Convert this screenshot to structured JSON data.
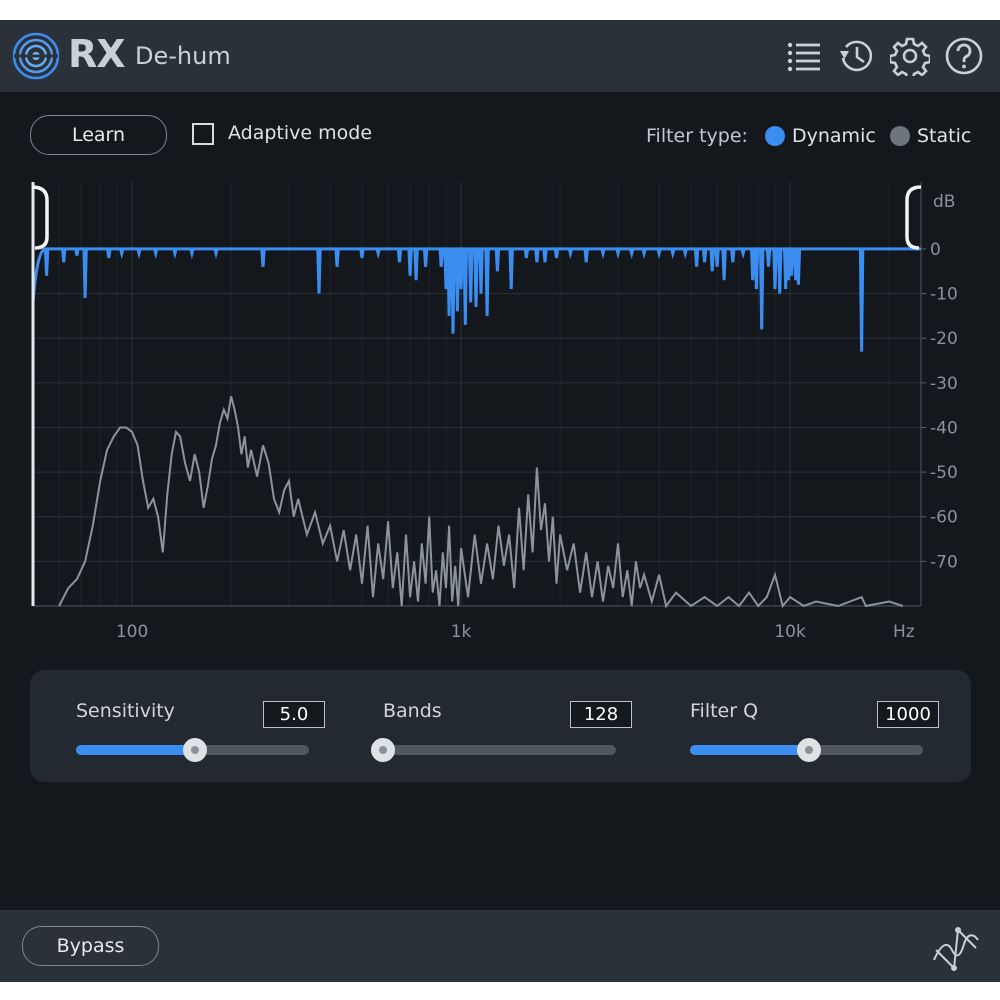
{
  "header": {
    "brand": "RX",
    "plugin_name": "De-hum",
    "icons": [
      "presets-list-icon",
      "history-icon",
      "settings-gear-icon",
      "help-icon"
    ]
  },
  "controls": {
    "learn_label": "Learn",
    "adaptive_mode_label": "Adaptive mode",
    "adaptive_mode_checked": false,
    "filter_type_label": "Filter type:",
    "filter_options": [
      "Dynamic",
      "Static"
    ],
    "filter_selected": "Dynamic"
  },
  "chart_data": {
    "type": "line",
    "x_scale": "log",
    "xlim": [
      50,
      25000
    ],
    "x_ticks": [
      {
        "value": 100,
        "label": "100"
      },
      {
        "value": 1000,
        "label": "1k"
      },
      {
        "value": 10000,
        "label": "10k"
      }
    ],
    "x_unit_label": "Hz",
    "y_unit_label": "dB",
    "ylim": [
      -80,
      15
    ],
    "y_ticks": [
      {
        "value": 0,
        "label": "0"
      },
      {
        "value": -10,
        "label": "-10"
      },
      {
        "value": -20,
        "label": "-20"
      },
      {
        "value": -30,
        "label": "-30"
      },
      {
        "value": -40,
        "label": "-40"
      },
      {
        "value": -50,
        "label": "-50"
      },
      {
        "value": -60,
        "label": "-60"
      },
      {
        "value": -70,
        "label": "-70"
      }
    ],
    "grid": true,
    "series": [
      {
        "role": "filter-response",
        "color": "#3b8ef0",
        "baseline_db": 0,
        "notches": [
          [
            55,
            -6
          ],
          [
            62,
            -3
          ],
          [
            68,
            -1.5
          ],
          [
            72,
            -11
          ],
          [
            85,
            -2
          ],
          [
            93,
            -1
          ],
          [
            105,
            -1
          ],
          [
            118,
            -1
          ],
          [
            135,
            -1
          ],
          [
            152,
            -1
          ],
          [
            180,
            -1
          ],
          [
            250,
            -4
          ],
          [
            370,
            -10
          ],
          [
            420,
            -4
          ],
          [
            500,
            -2
          ],
          [
            560,
            -1
          ],
          [
            650,
            -3
          ],
          [
            700,
            -6
          ],
          [
            730,
            -7
          ],
          [
            780,
            -4
          ],
          [
            870,
            -4
          ],
          [
            900,
            -9
          ],
          [
            920,
            -15
          ],
          [
            945,
            -19
          ],
          [
            975,
            -14
          ],
          [
            1000,
            -9
          ],
          [
            1030,
            -17
          ],
          [
            1070,
            -12
          ],
          [
            1110,
            -13
          ],
          [
            1150,
            -10
          ],
          [
            1200,
            -15
          ],
          [
            1290,
            -5
          ],
          [
            1420,
            -9
          ],
          [
            1580,
            -2
          ],
          [
            1700,
            -3
          ],
          [
            1800,
            -3
          ],
          [
            1950,
            -2
          ],
          [
            2150,
            -1
          ],
          [
            2400,
            -3
          ],
          [
            2700,
            -1
          ],
          [
            3000,
            -1
          ],
          [
            3300,
            -1
          ],
          [
            3600,
            -1
          ],
          [
            4000,
            -1
          ],
          [
            4400,
            -1
          ],
          [
            4800,
            -1
          ],
          [
            5200,
            -4
          ],
          [
            5500,
            -3
          ],
          [
            5800,
            -5
          ],
          [
            6000,
            -4
          ],
          [
            6300,
            -7
          ],
          [
            6700,
            -3
          ],
          [
            7200,
            -1
          ],
          [
            7700,
            -7
          ],
          [
            7900,
            -9
          ],
          [
            8200,
            -18
          ],
          [
            8600,
            -4
          ],
          [
            9000,
            -9
          ],
          [
            9300,
            -10
          ],
          [
            9700,
            -9
          ],
          [
            9900,
            -7
          ],
          [
            10100,
            -6
          ],
          [
            10400,
            -7
          ],
          [
            10600,
            -8
          ],
          [
            16500,
            -23
          ]
        ]
      },
      {
        "role": "input-spectrum",
        "color": "#8b939b",
        "points": [
          [
            60,
            -80
          ],
          [
            64,
            -76
          ],
          [
            68,
            -74
          ],
          [
            72,
            -70
          ],
          [
            76,
            -62
          ],
          [
            80,
            -52
          ],
          [
            84,
            -45
          ],
          [
            88,
            -42
          ],
          [
            92,
            -40
          ],
          [
            96,
            -40
          ],
          [
            100,
            -41
          ],
          [
            104,
            -44
          ],
          [
            108,
            -52
          ],
          [
            112,
            -58
          ],
          [
            116,
            -56
          ],
          [
            120,
            -60
          ],
          [
            124,
            -68
          ],
          [
            128,
            -55
          ],
          [
            132,
            -46
          ],
          [
            136,
            -41
          ],
          [
            140,
            -42
          ],
          [
            145,
            -48
          ],
          [
            150,
            -52
          ],
          [
            155,
            -46
          ],
          [
            160,
            -50
          ],
          [
            165,
            -58
          ],
          [
            170,
            -53
          ],
          [
            175,
            -47
          ],
          [
            180,
            -44
          ],
          [
            185,
            -39
          ],
          [
            190,
            -36
          ],
          [
            195,
            -38
          ],
          [
            200,
            -33
          ],
          [
            205,
            -36
          ],
          [
            210,
            -40
          ],
          [
            215,
            -46
          ],
          [
            220,
            -42
          ],
          [
            225,
            -49
          ],
          [
            230,
            -45
          ],
          [
            240,
            -51
          ],
          [
            250,
            -44
          ],
          [
            260,
            -48
          ],
          [
            270,
            -56
          ],
          [
            280,
            -59
          ],
          [
            290,
            -54
          ],
          [
            300,
            -52
          ],
          [
            310,
            -60
          ],
          [
            320,
            -56
          ],
          [
            340,
            -64
          ],
          [
            360,
            -59
          ],
          [
            380,
            -66
          ],
          [
            400,
            -62
          ],
          [
            420,
            -70
          ],
          [
            440,
            -63
          ],
          [
            460,
            -72
          ],
          [
            480,
            -64
          ],
          [
            500,
            -75
          ],
          [
            520,
            -62
          ],
          [
            540,
            -78
          ],
          [
            560,
            -66
          ],
          [
            580,
            -74
          ],
          [
            600,
            -61
          ],
          [
            620,
            -76
          ],
          [
            640,
            -68
          ],
          [
            660,
            -80
          ],
          [
            680,
            -64
          ],
          [
            700,
            -78
          ],
          [
            720,
            -70
          ],
          [
            740,
            -79
          ],
          [
            760,
            -66
          ],
          [
            780,
            -75
          ],
          [
            800,
            -60
          ],
          [
            820,
            -77
          ],
          [
            840,
            -72
          ],
          [
            860,
            -80
          ],
          [
            880,
            -68
          ],
          [
            900,
            -76
          ],
          [
            920,
            -62
          ],
          [
            940,
            -79
          ],
          [
            960,
            -71
          ],
          [
            980,
            -80
          ],
          [
            1000,
            -67
          ],
          [
            1050,
            -78
          ],
          [
            1100,
            -64
          ],
          [
            1150,
            -75
          ],
          [
            1200,
            -66
          ],
          [
            1250,
            -74
          ],
          [
            1300,
            -62
          ],
          [
            1350,
            -71
          ],
          [
            1400,
            -64
          ],
          [
            1450,
            -76
          ],
          [
            1500,
            -58
          ],
          [
            1550,
            -72
          ],
          [
            1600,
            -55
          ],
          [
            1650,
            -68
          ],
          [
            1700,
            -49
          ],
          [
            1750,
            -63
          ],
          [
            1800,
            -57
          ],
          [
            1850,
            -70
          ],
          [
            1900,
            -60
          ],
          [
            1950,
            -75
          ],
          [
            2000,
            -64
          ],
          [
            2100,
            -72
          ],
          [
            2200,
            -66
          ],
          [
            2300,
            -77
          ],
          [
            2400,
            -68
          ],
          [
            2500,
            -78
          ],
          [
            2600,
            -70
          ],
          [
            2700,
            -79
          ],
          [
            2800,
            -71
          ],
          [
            2900,
            -76
          ],
          [
            3000,
            -66
          ],
          [
            3100,
            -78
          ],
          [
            3200,
            -72
          ],
          [
            3300,
            -80
          ],
          [
            3400,
            -70
          ],
          [
            3500,
            -76
          ],
          [
            3600,
            -73
          ],
          [
            3800,
            -79
          ],
          [
            4000,
            -73
          ],
          [
            4200,
            -80
          ],
          [
            4500,
            -77
          ],
          [
            5000,
            -80
          ],
          [
            5500,
            -78
          ],
          [
            6000,
            -80
          ],
          [
            6500,
            -78
          ],
          [
            7000,
            -80
          ],
          [
            7500,
            -77
          ],
          [
            8000,
            -80
          ],
          [
            8500,
            -78
          ],
          [
            9000,
            -73
          ],
          [
            9500,
            -80
          ],
          [
            10000,
            -78
          ],
          [
            11000,
            -80
          ],
          [
            12000,
            -79
          ],
          [
            14000,
            -80
          ],
          [
            16500,
            -78
          ],
          [
            17000,
            -80
          ],
          [
            20000,
            -79
          ],
          [
            22000,
            -80
          ]
        ]
      }
    ]
  },
  "sliders": [
    {
      "label": "Sensitivity",
      "value": "5.0",
      "fraction": 0.51
    },
    {
      "label": "Bands",
      "value": "128",
      "fraction": 0.0
    },
    {
      "label": "Filter Q",
      "value": "1000",
      "fraction": 0.51
    }
  ],
  "footer": {
    "bypass_label": "Bypass"
  },
  "colors": {
    "accent": "#3b8ef0",
    "background": "#14181d",
    "bar": "#2a3139"
  }
}
